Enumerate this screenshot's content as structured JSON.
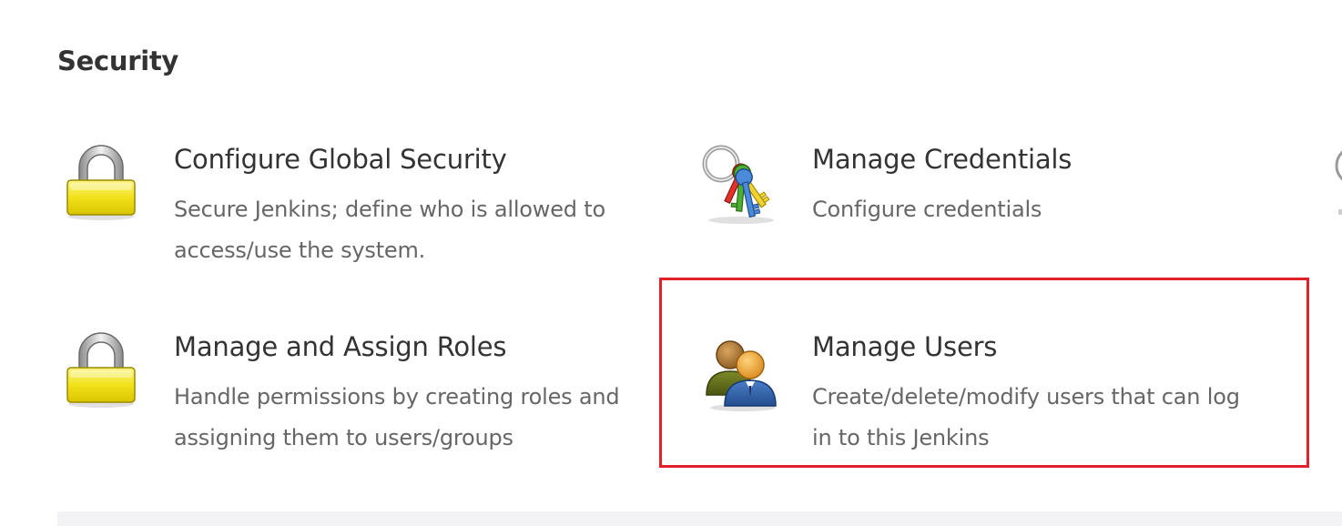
{
  "section": {
    "title": "Security"
  },
  "items": [
    {
      "id": "configure-global-security",
      "icon": "lock-icon",
      "title": "Configure Global Security",
      "description": "Secure Jenkins; define who is allowed to access/use the system."
    },
    {
      "id": "manage-credentials",
      "icon": "keys-icon",
      "title": "Manage Credentials",
      "description": "Configure credentials"
    },
    {
      "id": "manage-and-assign-roles",
      "icon": "lock-icon",
      "title": "Manage and Assign Roles",
      "description": "Handle permissions by creating roles and assigning them to users/groups"
    },
    {
      "id": "manage-users",
      "icon": "users-icon",
      "title": "Manage Users",
      "description": "Create/delete/modify users that can log in to this Jenkins",
      "highlighted": true
    }
  ],
  "colors": {
    "highlight": "#e0202a",
    "title_text": "#333333",
    "description_text": "#666666"
  }
}
